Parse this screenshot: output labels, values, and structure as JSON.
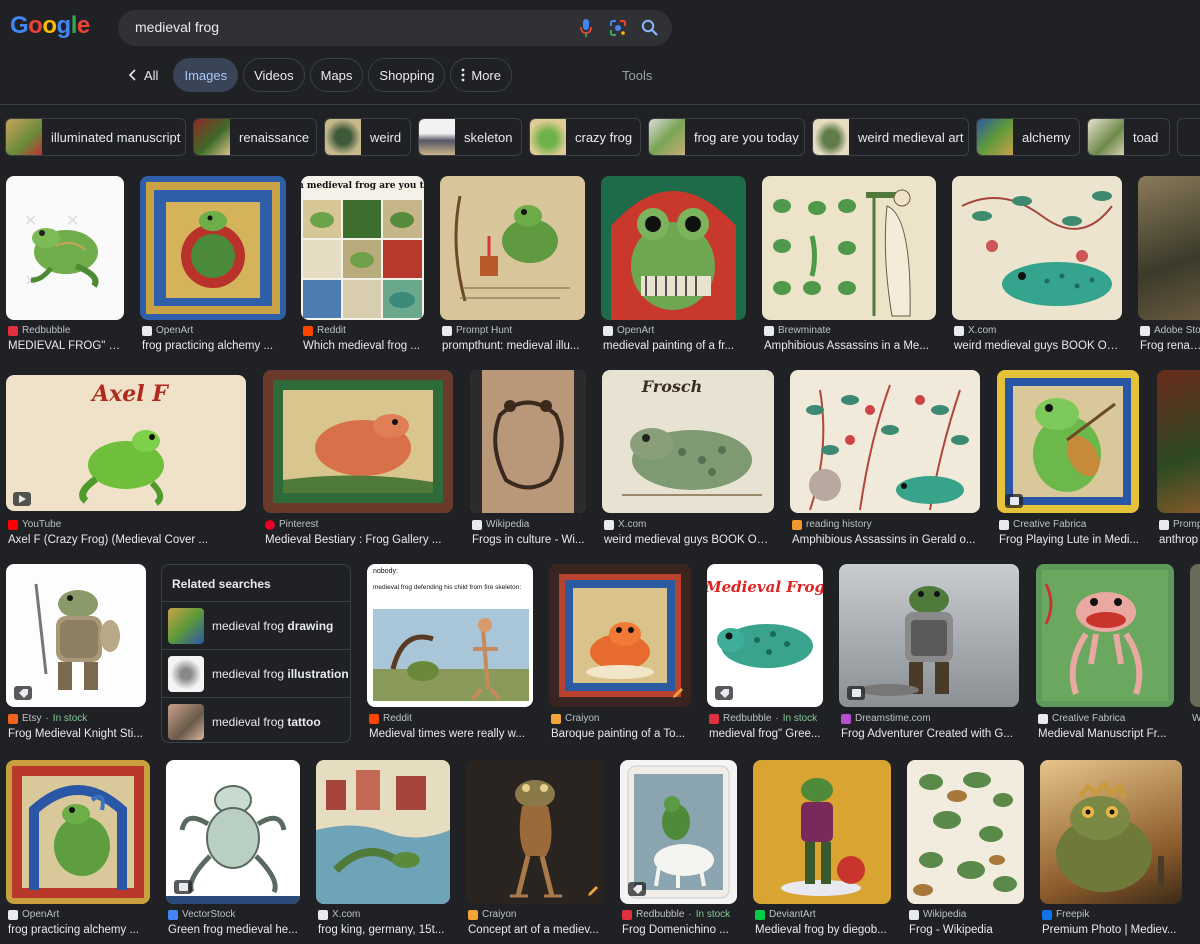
{
  "logo": {
    "letters": [
      "G",
      "o",
      "o",
      "g",
      "l",
      "e"
    ],
    "colors": [
      "#4285f4",
      "#ea4335",
      "#fbbc05",
      "#4285f4",
      "#34a853",
      "#ea4335"
    ]
  },
  "search": {
    "query": "medieval frog"
  },
  "tabs": [
    {
      "label": "All",
      "active": false
    },
    {
      "label": "Images",
      "active": true
    },
    {
      "label": "Videos",
      "active": false
    },
    {
      "label": "Maps",
      "active": false
    },
    {
      "label": "Shopping",
      "active": false
    },
    {
      "label": "More",
      "active": false
    }
  ],
  "tools_label": "Tools",
  "chips": [
    {
      "label": "illuminated manuscript"
    },
    {
      "label": "renaissance"
    },
    {
      "label": "weird"
    },
    {
      "label": "skeleton"
    },
    {
      "label": "crazy frog"
    },
    {
      "label": "frog are you today"
    },
    {
      "label": "weird medieval art"
    },
    {
      "label": "alchemy"
    },
    {
      "label": "toad"
    }
  ],
  "related": {
    "title": "Related searches",
    "items": [
      {
        "prefix": "medieval frog ",
        "bold": "drawing"
      },
      {
        "prefix": "medieval frog ",
        "bold": "illustration"
      },
      {
        "prefix": "medieval frog ",
        "bold": "tattoo"
      }
    ]
  },
  "results": [
    {
      "source": "Redbubble",
      "title": "MEDIEVAL FROG\" P...",
      "stock": ""
    },
    {
      "source": "OpenArt",
      "title": "frog practicing alchemy ...",
      "stock": ""
    },
    {
      "source": "Reddit",
      "title": "Which medieval frog ...",
      "stock": ""
    },
    {
      "source": "Prompt Hunt",
      "title": "prompthunt: medieval illu...",
      "stock": ""
    },
    {
      "source": "OpenArt",
      "title": "medieval painting of a fr...",
      "stock": ""
    },
    {
      "source": "Brewminate",
      "title": "Amphibious Assassins in a Me...",
      "stock": ""
    },
    {
      "source": "X.com",
      "title": "weird medieval guys BOOK OU...",
      "stock": ""
    },
    {
      "source": "Adobe Stock",
      "title": "Frog renaiss",
      "stock": ""
    },
    {
      "source": "YouTube",
      "title": "Axel F (Crazy Frog) (Medieval Cover ...",
      "stock": ""
    },
    {
      "source": "Pinterest",
      "title": "Medieval Bestiary : Frog Gallery ...",
      "stock": ""
    },
    {
      "source": "Wikipedia",
      "title": "Frogs in culture - Wi...",
      "stock": ""
    },
    {
      "source": "X.com",
      "title": "weird medieval guys BOOK OU...",
      "stock": ""
    },
    {
      "source": "reading history",
      "title": "Amphibious Assassins in Gerald o...",
      "stock": ""
    },
    {
      "source": "Creative Fabrica",
      "title": "Frog Playing Lute in Medi...",
      "stock": ""
    },
    {
      "source": "Prompt",
      "title": "anthrop",
      "stock": ""
    },
    {
      "source": "Etsy",
      "title": "Frog Medieval Knight Sti...",
      "stock": "In stock"
    },
    {
      "source": "Reddit",
      "title": "Medieval times were really w...",
      "stock": ""
    },
    {
      "source": "Craiyon",
      "title": "Baroque painting of a To...",
      "stock": ""
    },
    {
      "source": "Redbubble",
      "title": "medieval frog\" Gree...",
      "stock": "In stock"
    },
    {
      "source": "Dreamstime.com",
      "title": "Frog Adventurer Created with G...",
      "stock": ""
    },
    {
      "source": "Creative Fabrica",
      "title": "Medieval Manuscript Fr...",
      "stock": ""
    },
    {
      "source": "W",
      "title": "",
      "stock": ""
    },
    {
      "source": "OpenArt",
      "title": "frog practicing alchemy ...",
      "stock": ""
    },
    {
      "source": "VectorStock",
      "title": "Green frog medieval he...",
      "stock": ""
    },
    {
      "source": "X.com",
      "title": "frog king, germany, 15t...",
      "stock": ""
    },
    {
      "source": "Craiyon",
      "title": "Concept art of a mediev...",
      "stock": ""
    },
    {
      "source": "Redbubble",
      "title": "Frog Domenichino ...",
      "stock": "In stock"
    },
    {
      "source": "DeviantArt",
      "title": "Medieval frog by diegob...",
      "stock": ""
    },
    {
      "source": "Wikipedia",
      "title": "Frog - Wikipedia",
      "stock": ""
    },
    {
      "source": "Freepik",
      "title": "Premium Photo | Mediev...",
      "stock": ""
    }
  ],
  "image_texts": {
    "which_frog": "Which medieval frog are you today?",
    "axel_f": "Axel F",
    "frosch": "Frosch",
    "nobody": "nobody:",
    "nobody_caption": "medieval frog defending his child from fire skeleton:",
    "medieval_frog_logo": "Medieval Frog"
  }
}
